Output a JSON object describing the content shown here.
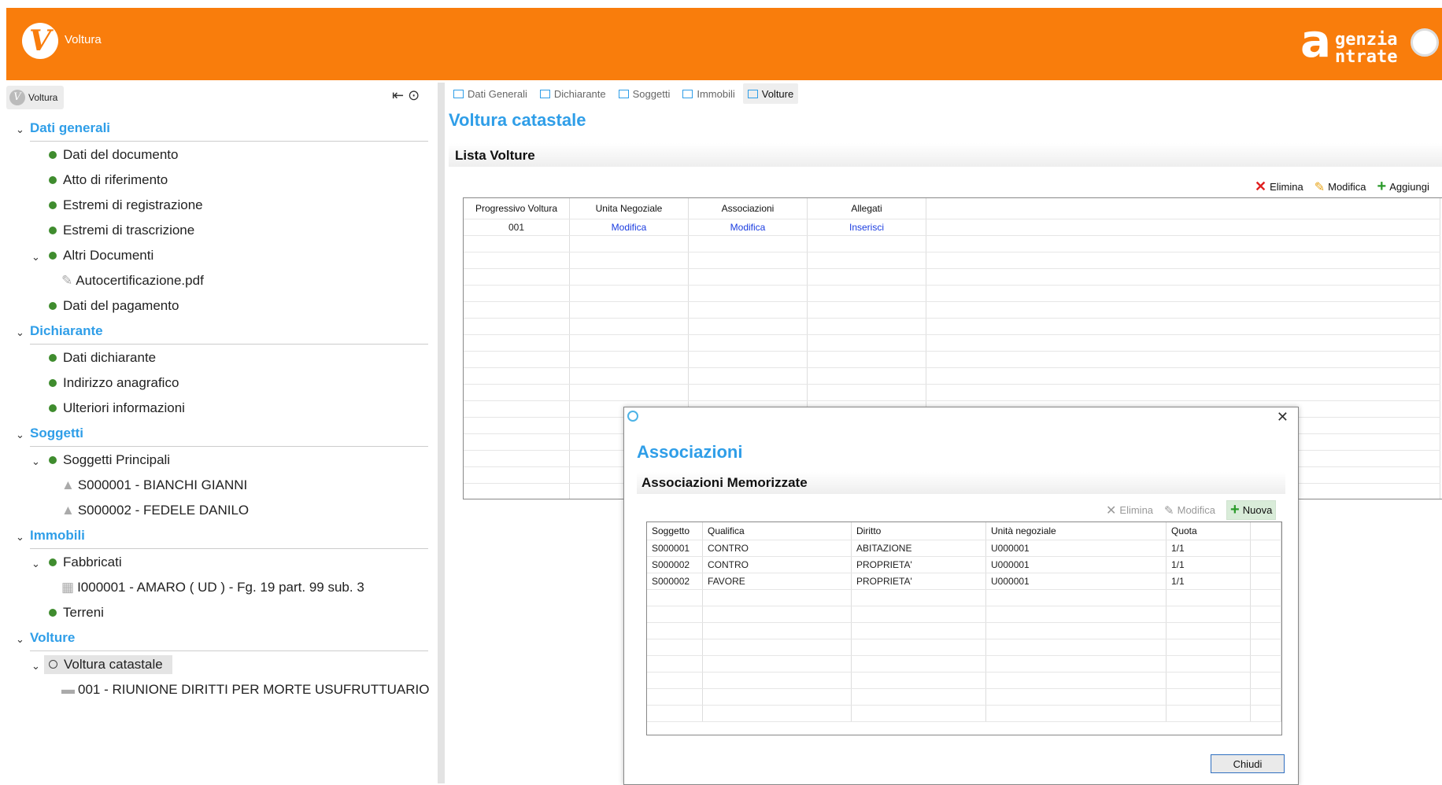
{
  "header": {
    "logo_letter": "V",
    "app_name": "Voltura",
    "brand_a": "a",
    "brand_line1": "genzia",
    "brand_line2": "ntrate"
  },
  "sidebar": {
    "tab_label": "Voltura",
    "sections": {
      "dati_generali": "Dati generali",
      "dichiarante": "Dichiarante",
      "soggetti": "Soggetti",
      "immobili": "Immobili",
      "volture": "Volture"
    },
    "items": {
      "dati_documento": "Dati del documento",
      "atto_riferimento": "Atto di riferimento",
      "estremi_registrazione": "Estremi di registrazione",
      "estremi_trascrizione": "Estremi di trascrizione",
      "altri_documenti": "Altri Documenti",
      "autocertificazione": "Autocertificazione.pdf",
      "dati_pagamento": "Dati del pagamento",
      "dati_dichiarante": "Dati dichiarante",
      "indirizzo_anagrafico": "Indirizzo anagrafico",
      "ulteriori_informazioni": "Ulteriori informazioni",
      "soggetti_principali": "Soggetti Principali",
      "soggetto1": "S000001 - BIANCHI GIANNI",
      "soggetto2": "S000002 - FEDELE DANILO",
      "fabbricati": "Fabbricati",
      "immobile1": "I000001 - AMARO ( UD ) - Fg. 19 part. 99 sub. 3",
      "terreni": "Terreni",
      "voltura_catastale": "Voltura catastale",
      "voltura001": "001 - RIUNIONE DIRITTI PER MORTE USUFRUTTUARIO"
    }
  },
  "tabs": [
    "Dati Generali",
    "Dichiarante",
    "Soggetti",
    "Immobili",
    "Volture"
  ],
  "main": {
    "title": "Voltura catastale",
    "section": "Lista Volture",
    "actions": {
      "elimina": "Elimina",
      "modifica": "Modifica",
      "aggiungi": "Aggiungi"
    },
    "columns": [
      "Progressivo Voltura",
      "Unita Negoziale",
      "Associazioni",
      "Allegati"
    ],
    "rows": [
      [
        "001",
        "Modifica",
        "Modifica",
        "Inserisci"
      ]
    ]
  },
  "dialog": {
    "title": "Associazioni",
    "section": "Associazioni Memorizzate",
    "actions": {
      "elimina": "Elimina",
      "modifica": "Modifica",
      "nuova": "Nuova"
    },
    "columns": [
      "Soggetto",
      "Qualifica",
      "Diritto",
      "Unità negoziale",
      "Quota"
    ],
    "rows": [
      [
        "S000001",
        "CONTRO",
        "ABITAZIONE",
        "U000001",
        "1/1"
      ],
      [
        "S000002",
        "CONTRO",
        "PROPRIETA'",
        "U000001",
        "1/1"
      ],
      [
        "S000002",
        "FAVORE",
        "PROPRIETA'",
        "U000001",
        "1/1"
      ]
    ],
    "close_label": "Chiudi"
  }
}
